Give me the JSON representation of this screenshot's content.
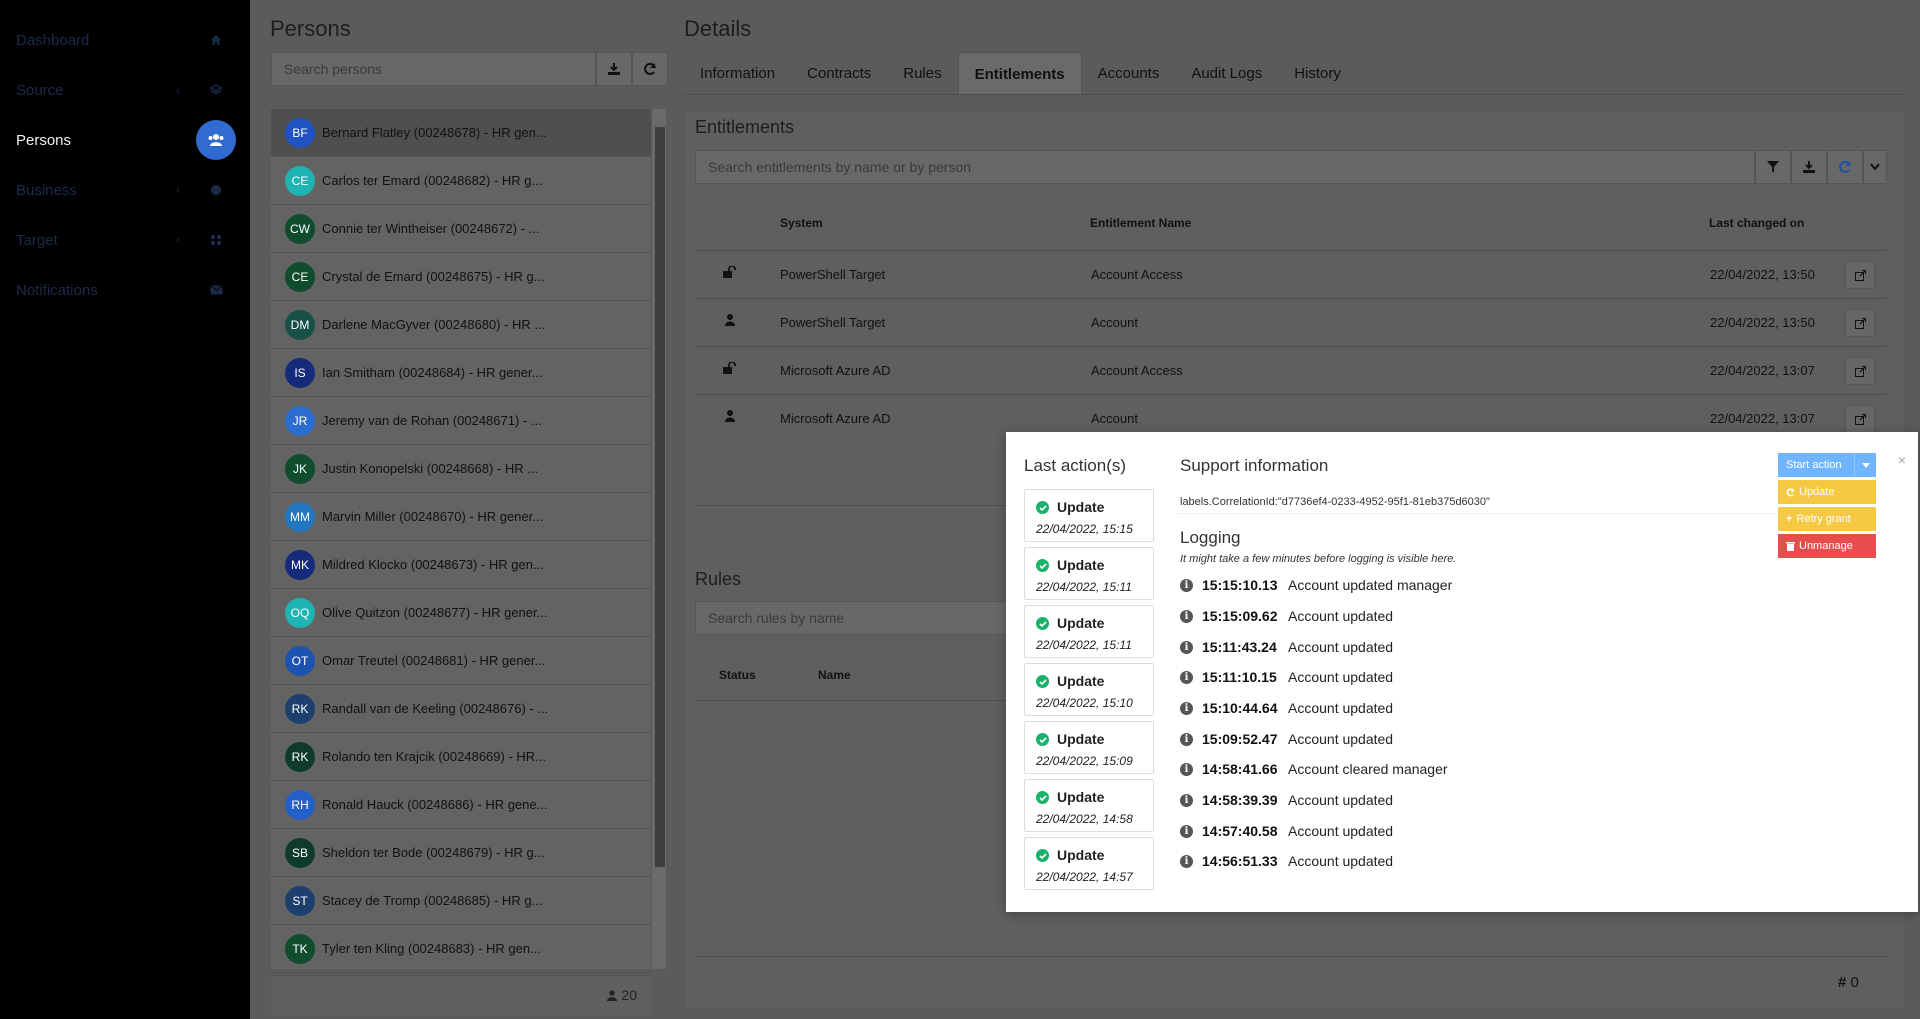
{
  "sidebar": {
    "items": [
      {
        "label": "Dashboard",
        "icon": "home-icon"
      },
      {
        "label": "Source",
        "icon": "layers-icon"
      },
      {
        "label": "Persons",
        "icon": "users-icon"
      },
      {
        "label": "Business",
        "icon": "globe-icon"
      },
      {
        "label": "Target",
        "icon": "grid-icon"
      },
      {
        "label": "Notifications",
        "icon": "envelope-icon"
      }
    ],
    "chevron": "‹"
  },
  "persons": {
    "title": "Persons",
    "search_placeholder": "Search persons",
    "count": "20",
    "items": [
      {
        "initials": "BF",
        "name": "Bernard Flatley (00248678) - HR gen...",
        "color": "#2152c4"
      },
      {
        "initials": "CE",
        "name": "Carlos ter Emard (00248682) - HR g...",
        "color": "#1fb4b4"
      },
      {
        "initials": "CW",
        "name": "Connie ter Wintheiser (00248672) - ...",
        "color": "#0f4d2e"
      },
      {
        "initials": "CE",
        "name": "Crystal de Emard (00248675) - HR g...",
        "color": "#0f4d2e"
      },
      {
        "initials": "DM",
        "name": "Darlene MacGyver (00248680) - HR ...",
        "color": "#165049"
      },
      {
        "initials": "IS",
        "name": "Ian Smitham (00248684) - HR gener...",
        "color": "#142a7a"
      },
      {
        "initials": "JR",
        "name": "Jeremy van de Rohan (00248671) - ...",
        "color": "#2b6ecf"
      },
      {
        "initials": "JK",
        "name": "Justin Konopelski (00248668) - HR ...",
        "color": "#0f4d2e"
      },
      {
        "initials": "MM",
        "name": "Marvin Miller (00248670) - HR gener...",
        "color": "#2376c0"
      },
      {
        "initials": "MK",
        "name": "Mildred Klocko (00248673) - HR gen...",
        "color": "#142a7a"
      },
      {
        "initials": "OQ",
        "name": "Olive Quitzon (00248677) - HR gener...",
        "color": "#1fb4b4"
      },
      {
        "initials": "OT",
        "name": "Omar Treutel (00248681) - HR gener...",
        "color": "#1c52b0"
      },
      {
        "initials": "RK",
        "name": "Randall van de Keeling (00248676) - ...",
        "color": "#1c3f6e"
      },
      {
        "initials": "RK",
        "name": "Rolando ten Krajcik (00248669) - HR...",
        "color": "#0f3a2e"
      },
      {
        "initials": "RH",
        "name": "Ronald Hauck (00248686) - HR gene...",
        "color": "#2560c8"
      },
      {
        "initials": "SB",
        "name": "Sheldon ter Bode (00248679) - HR g...",
        "color": "#0f3a2e"
      },
      {
        "initials": "ST",
        "name": "Stacey de Tromp (00248685) - HR g...",
        "color": "#1c3f6e"
      },
      {
        "initials": "TK",
        "name": "Tyler ten Kling (00248683) - HR gen...",
        "color": "#0f4d2e"
      }
    ]
  },
  "details": {
    "title": "Details",
    "tabs": [
      "Information",
      "Contracts",
      "Rules",
      "Entitlements",
      "Accounts",
      "Audit Logs",
      "History"
    ],
    "active_tab": "Entitlements"
  },
  "entitlements": {
    "title": "Entitlements",
    "search_placeholder": "Search entitlements by name or by person",
    "headers": {
      "system": "System",
      "name": "Entitlement Name",
      "changed": "Last changed on"
    },
    "rows": [
      {
        "icon": "unlock-icon",
        "system": "PowerShell Target",
        "name": "Account Access",
        "changed": "22/04/2022, 13:50"
      },
      {
        "icon": "user-icon",
        "system": "PowerShell Target",
        "name": "Account",
        "changed": "22/04/2022, 13:50"
      },
      {
        "icon": "unlock-icon",
        "system": "Microsoft Azure AD",
        "name": "Account Access",
        "changed": "22/04/2022, 13:07"
      },
      {
        "icon": "user-icon",
        "system": "Microsoft Azure AD",
        "name": "Account",
        "changed": "22/04/2022, 13:07"
      }
    ]
  },
  "rules": {
    "title": "Rules",
    "search_placeholder": "Search rules by name",
    "headers": {
      "status": "Status",
      "name": "Name"
    },
    "count": "0"
  },
  "modal": {
    "last_actions_title": "Last action(s)",
    "actions": [
      {
        "label": "Update",
        "date": "22/04/2022, 15:15"
      },
      {
        "label": "Update",
        "date": "22/04/2022, 15:11"
      },
      {
        "label": "Update",
        "date": "22/04/2022, 15:11"
      },
      {
        "label": "Update",
        "date": "22/04/2022, 15:10"
      },
      {
        "label": "Update",
        "date": "22/04/2022, 15:09"
      },
      {
        "label": "Update",
        "date": "22/04/2022, 14:58"
      },
      {
        "label": "Update",
        "date": "22/04/2022, 14:57"
      }
    ],
    "support_title": "Support information",
    "correlation": "labels.CorrelationId:\"d7736ef4-0233-4952-95f1-81eb375d6030\"",
    "logging_title": "Logging",
    "logging_note": "It might take a few minutes before logging is visible here.",
    "logs": [
      {
        "time": "15:15:10.13",
        "msg": "Account updated manager"
      },
      {
        "time": "15:15:09.62",
        "msg": "Account updated"
      },
      {
        "time": "15:11:43.24",
        "msg": "Account updated"
      },
      {
        "time": "15:11:10.15",
        "msg": "Account updated"
      },
      {
        "time": "15:10:44.64",
        "msg": "Account updated"
      },
      {
        "time": "15:09:52.47",
        "msg": "Account updated"
      },
      {
        "time": "14:58:41.66",
        "msg": "Account cleared manager"
      },
      {
        "time": "14:58:39.39",
        "msg": "Account updated"
      },
      {
        "time": "14:57:40.58",
        "msg": "Account updated"
      },
      {
        "time": "14:56:51.33",
        "msg": "Account updated"
      }
    ],
    "buttons": {
      "start_action": "Start action",
      "update": "Update",
      "retry": "Retry grant",
      "unmanage": "Unmanage"
    },
    "close": "×"
  },
  "colors": {
    "start_action": "#6fb6ff",
    "update": "#f6c945",
    "retry": "#f6c945",
    "unmanage": "#e84d4d",
    "success": "#19b26b"
  }
}
